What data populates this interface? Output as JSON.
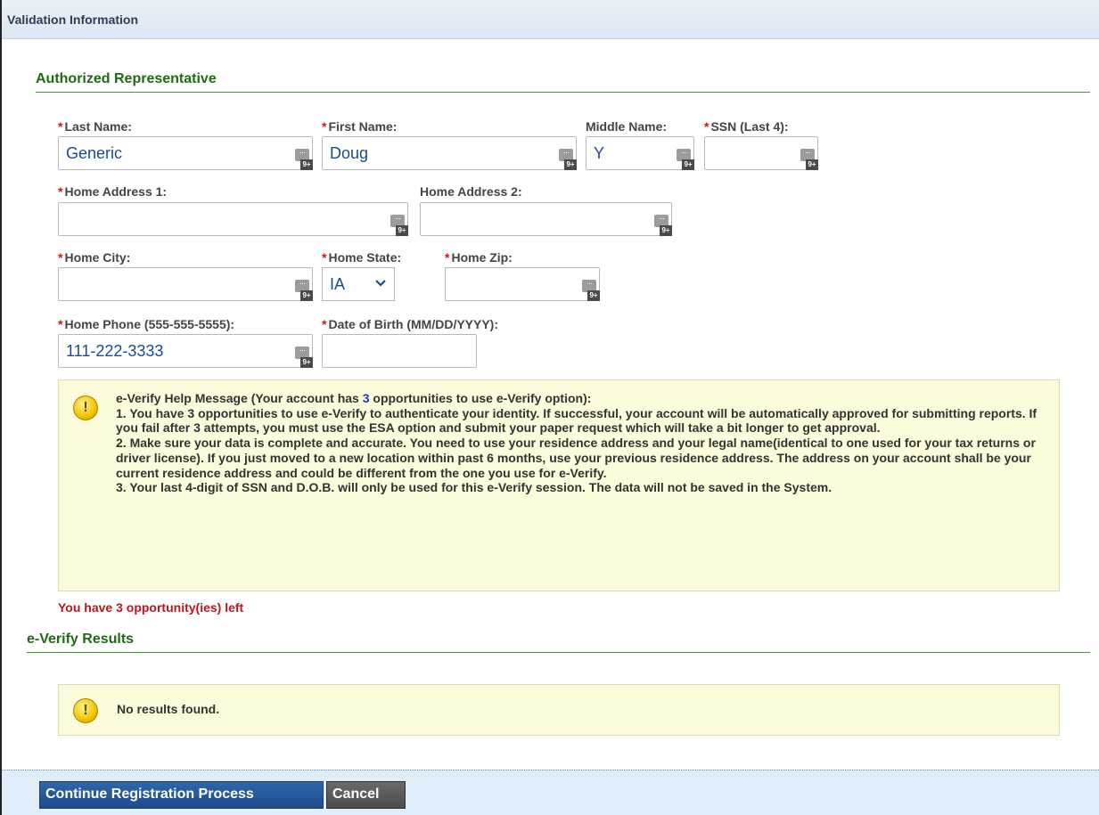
{
  "panel": {
    "title": "Validation Information"
  },
  "authorized_rep": {
    "section_title": "Authorized Representative",
    "last_name": {
      "label": "Last Name:",
      "value": "Generic",
      "required": true
    },
    "first_name": {
      "label": "First Name:",
      "value": "Doug",
      "required": true
    },
    "middle_name": {
      "label": "Middle Name:",
      "value": "Y",
      "required": false
    },
    "ssn_last4": {
      "label": "SSN (Last 4):",
      "value": "",
      "required": true
    },
    "home_address_1": {
      "label": "Home Address 1:",
      "value": "",
      "required": true
    },
    "home_address_2": {
      "label": "Home Address 2:",
      "value": "",
      "required": false
    },
    "home_city": {
      "label": "Home City:",
      "value": "",
      "required": true
    },
    "home_state": {
      "label": "Home State:",
      "value": "IA",
      "required": true
    },
    "home_zip": {
      "label": "Home Zip:",
      "value": "",
      "required": true
    },
    "home_phone": {
      "label": "Home Phone (555-555-5555):",
      "value": "111-222-3333",
      "required": true
    },
    "dob": {
      "label": "Date of Birth (MM/DD/YYYY):",
      "value": "",
      "required": true
    },
    "keyboard_badge": "9+",
    "keyboard_dots": "···"
  },
  "help": {
    "icon": "warning-icon",
    "intro_prefix": "e-Verify Help Message (Your account has ",
    "intro_count": "3",
    "intro_suffix": " opportunities to use e-Verify option):",
    "line1": "1. You have 3 opportunities to use e-Verify to authenticate your identity. If successful, your account will be automatically approved for submitting reports. If you fail after 3 attempts, you must use the ESA option and submit your paper request which will take a bit longer to get approval.",
    "line2": "2. Make sure your data is complete and accurate. You need to use your residence address and your legal name(identical to one used for your tax returns or driver license). If you just moved to a new location within past 6 months, use your previous residence address. The address on your account shall be your current residence address and could be different from the one you use for e-Verify.",
    "line3": "3. Your last 4-digit of SSN and D.O.B. will only be used for this e-Verify session. The data will not be saved in the System."
  },
  "opportunities_left": "You have 3 opportunity(ies) left",
  "results": {
    "section_title": "e-Verify Results",
    "message": "No results found."
  },
  "actions": {
    "continue_label": "Continue Registration Process",
    "cancel_label": "Cancel"
  },
  "colors": {
    "section_title": "#1e6b12",
    "required_asterisk": "#d11111",
    "field_value": "#1a4c8f",
    "warning_text": "#c0141a",
    "message_bg": "#fcfbdc",
    "primary_button": "#1d4c8a"
  }
}
